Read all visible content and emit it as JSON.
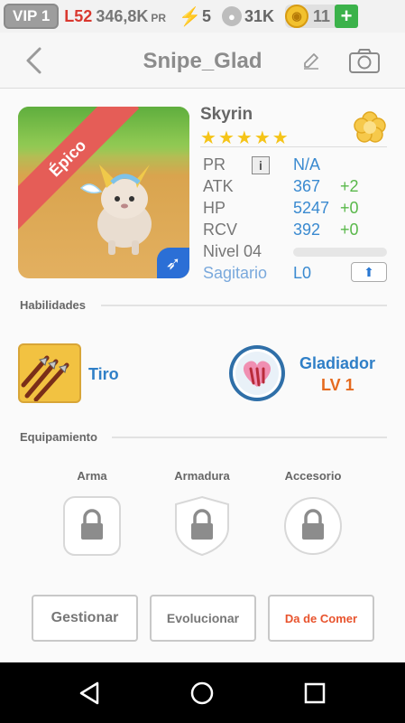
{
  "statusbar": {
    "vip": "VIP 1",
    "level": "L52",
    "power_value": "346,8K",
    "power_unit": "PR",
    "energy": "5",
    "paws": "31K",
    "coins": "11",
    "plus": "+"
  },
  "header": {
    "title": "Snipe_Glad",
    "icons": [
      "back-icon",
      "edit-icon",
      "camera-icon"
    ]
  },
  "pet": {
    "rarity": "Épico",
    "name": "Skyrin",
    "stars": 5,
    "star_glyph": "★",
    "stats": [
      {
        "label": "PR",
        "value": "N/A",
        "bonus": ""
      },
      {
        "label": "ATK",
        "value": "367",
        "bonus": "+2"
      },
      {
        "label": "HP",
        "value": "5247",
        "bonus": "+0"
      },
      {
        "label": "RCV",
        "value": "392",
        "bonus": "+0"
      }
    ],
    "info_glyph": "i",
    "level_label": "Nivel 04",
    "level_progress": 0,
    "sign": "Sagitario",
    "sign_level": "L0"
  },
  "sections": {
    "skills_title": "Habilidades",
    "equipment_title": "Equipamiento"
  },
  "skills": {
    "skill_name": "Tiro",
    "class_name": "Gladiador",
    "class_level": "LV 1"
  },
  "equipment": {
    "slots": [
      "Arma",
      "Armadura",
      "Accesorio"
    ]
  },
  "actions": {
    "manage": "Gestionar",
    "evolve": "Evolucionar",
    "feed": "Da de Comer"
  },
  "colors": {
    "accent_blue": "#2f7fc7",
    "stat_blue": "#3a8ad0",
    "bonus_green": "#59b84a",
    "epic_red": "#e55d57",
    "level_orange": "#e56a1f",
    "feed_red": "#e8532d"
  }
}
